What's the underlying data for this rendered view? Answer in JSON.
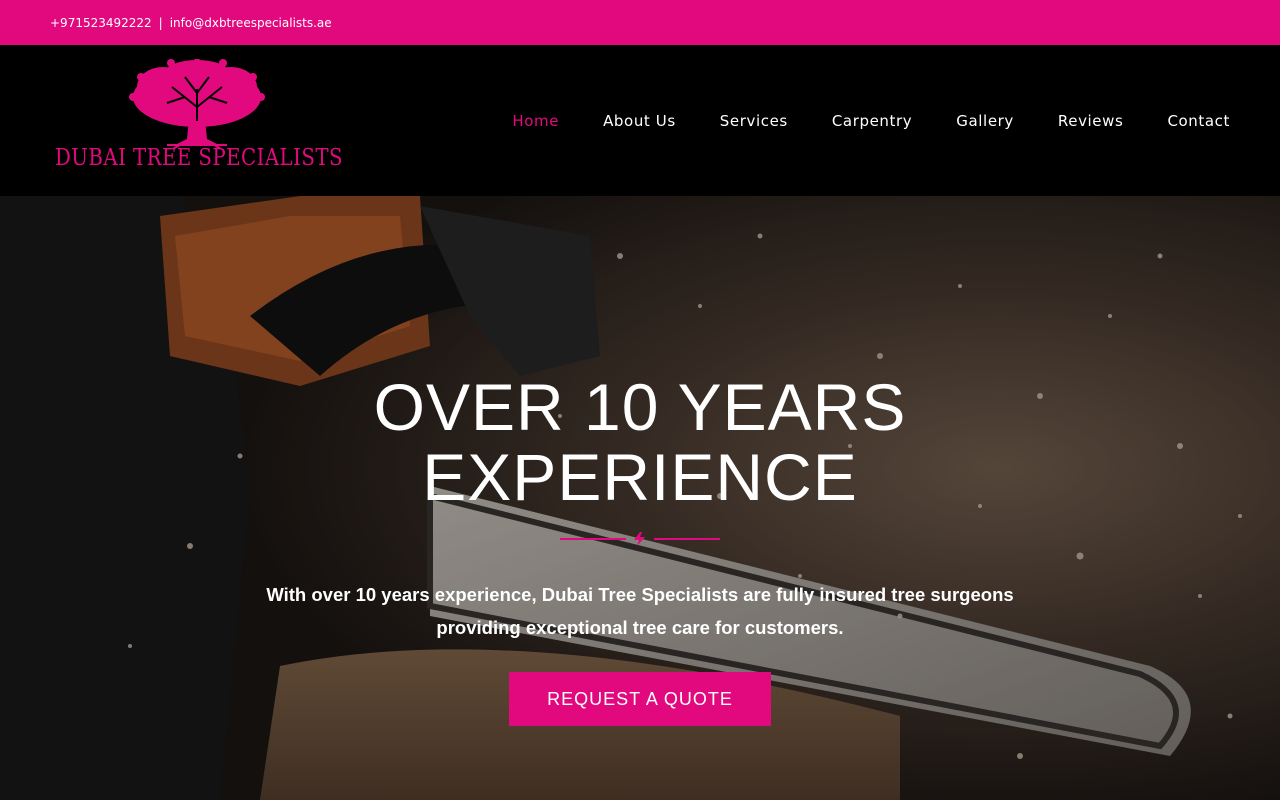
{
  "topbar": {
    "phone": "+971523492222",
    "separator": "|",
    "email": "info@dxbtreespecialists.ae"
  },
  "brand": {
    "name": "DUBAI TREE SPECIALISTS",
    "logo_icon": "tree-icon",
    "accent_color": "#e2097f"
  },
  "nav": {
    "items": [
      {
        "label": "Home",
        "active": true
      },
      {
        "label": "About Us"
      },
      {
        "label": "Services"
      },
      {
        "label": "Carpentry"
      },
      {
        "label": "Gallery"
      },
      {
        "label": "Reviews"
      },
      {
        "label": "Contact"
      }
    ]
  },
  "hero": {
    "title_line1": "OVER 10 YEARS",
    "title_line2": "EXPERIENCE",
    "divider_icon": "lightning-icon",
    "text_line1": "With over 10 years experience, Dubai Tree Specialists are fully insured tree surgeons",
    "text_line2": "providing exceptional tree care for customers.",
    "cta_label": "REQUEST A QUOTE",
    "background": "chainsaw-cutting-wood-photo"
  }
}
